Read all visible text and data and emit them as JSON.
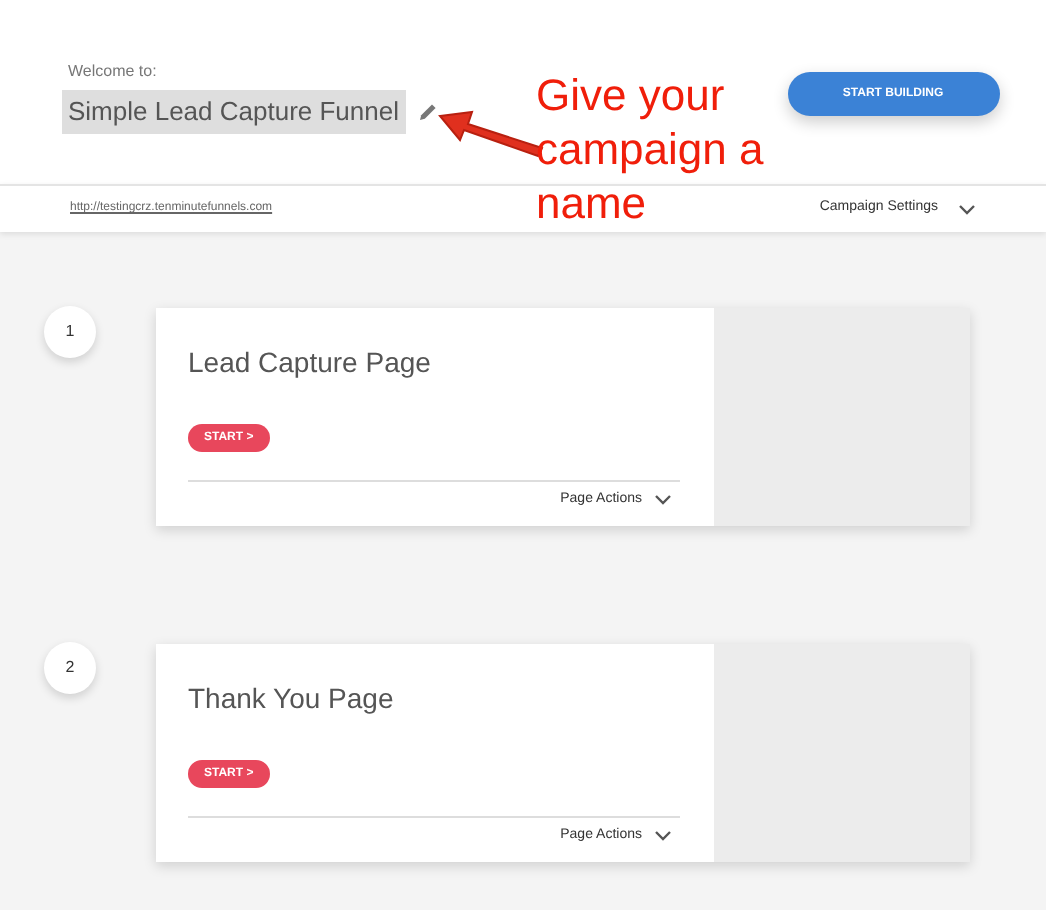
{
  "header": {
    "welcome": "Welcome to:",
    "campaign_name": "Simple Lead Capture Funnel",
    "start_button": "START BUILDING"
  },
  "annotation": {
    "text": "Give your campaign a name"
  },
  "toolbar": {
    "url": "http://testingcrz.tenminutefunnels.com",
    "settings": "Campaign Settings"
  },
  "steps": [
    {
      "number": "1",
      "title": "Lead Capture Page",
      "start": "START >",
      "actions": "Page Actions"
    },
    {
      "number": "2",
      "title": "Thank You Page",
      "start": "START >",
      "actions": "Page Actions"
    }
  ]
}
